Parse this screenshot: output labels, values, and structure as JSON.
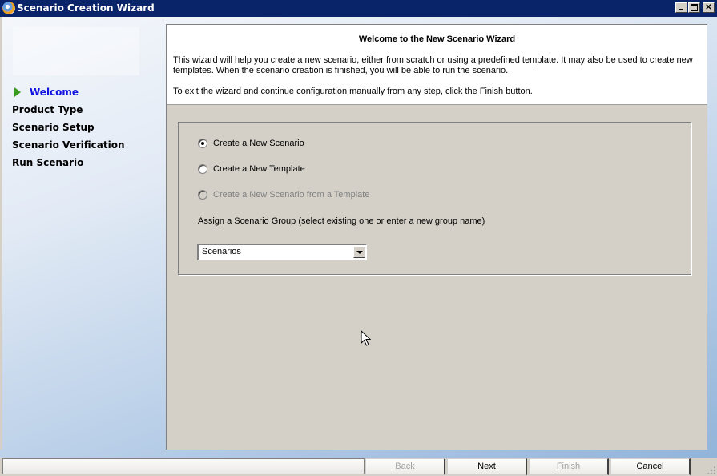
{
  "window": {
    "title": "Scenario Creation Wizard",
    "controls": [
      "minimize",
      "maximize",
      "close"
    ]
  },
  "sidebar": {
    "steps": [
      {
        "label": "Welcome",
        "active": true
      },
      {
        "label": "Product Type",
        "active": false
      },
      {
        "label": "Scenario Setup",
        "active": false
      },
      {
        "label": "Scenario Verification",
        "active": false
      },
      {
        "label": "Run Scenario",
        "active": false
      }
    ]
  },
  "header": {
    "title": "Welcome to the New Scenario Wizard",
    "paragraph1": "This wizard will help you create a new scenario, either from scratch or using a predefined template. It may also be used to create new templates. When the scenario creation is finished, you will be able to run the scenario.",
    "paragraph2": "To exit the wizard and continue configuration manually from any step, click the Finish button."
  },
  "options": {
    "radios": [
      {
        "label": "Create a New Scenario",
        "checked": true,
        "disabled": false
      },
      {
        "label": "Create a New Template",
        "checked": false,
        "disabled": false
      },
      {
        "label": "Create a New Scenario from a Template",
        "checked": false,
        "disabled": true
      }
    ],
    "group_label": "Assign a Scenario Group (select existing one or enter a new group name)",
    "group_value": "Scenarios"
  },
  "footer": {
    "status_text": "",
    "buttons": {
      "back": {
        "label": "Back",
        "mnemonic": "B",
        "rest": "ack",
        "disabled": true
      },
      "next": {
        "label": "Next",
        "mnemonic": "N",
        "rest": "ext",
        "disabled": false
      },
      "finish": {
        "label": "Finish",
        "mnemonic": "F",
        "rest": "inish",
        "disabled": true
      },
      "cancel": {
        "label": "Cancel",
        "mnemonic": "C",
        "rest": "ancel",
        "disabled": false
      }
    }
  }
}
